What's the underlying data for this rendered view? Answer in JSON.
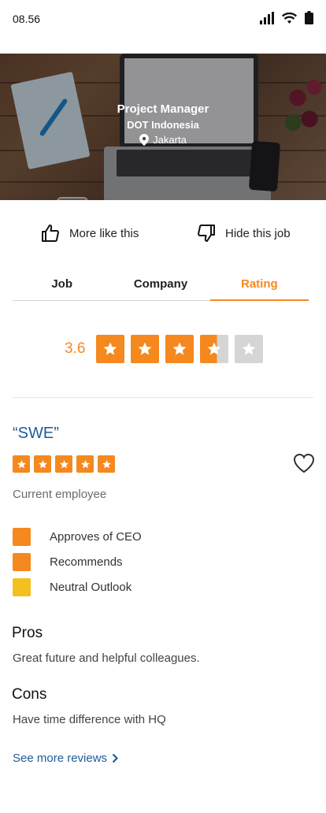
{
  "status_bar": {
    "time": "08.56"
  },
  "job": {
    "title": "Project Manager",
    "company": "DOT Indonesia",
    "location": "Jakarta"
  },
  "actions": {
    "more_like_this": "More like this",
    "hide_this_job": "Hide this job"
  },
  "tabs": [
    {
      "label": "Job",
      "active": false
    },
    {
      "label": "Company",
      "active": false
    },
    {
      "label": "Rating",
      "active": true
    }
  ],
  "rating": {
    "value_text": "3.6",
    "value": 3.6,
    "max": 5
  },
  "review": {
    "title": "“SWE”",
    "stars": 5,
    "reviewer_status": "Current employee",
    "indicators": [
      {
        "label": "Approves of CEO",
        "color": "#f5891f"
      },
      {
        "label": "Recommends",
        "color": "#f5891f"
      },
      {
        "label": "Neutral Outlook",
        "color": "#f4c01e"
      }
    ],
    "pros_heading": "Pros",
    "pros_text": "Great future and helpful colleagues.",
    "cons_heading": "Cons",
    "cons_text": "Have time difference with HQ"
  },
  "see_more": {
    "label": "See more reviews"
  },
  "colors": {
    "accent": "#f5891f",
    "link": "#1f5b9a",
    "star_empty": "#d5d5d5"
  }
}
